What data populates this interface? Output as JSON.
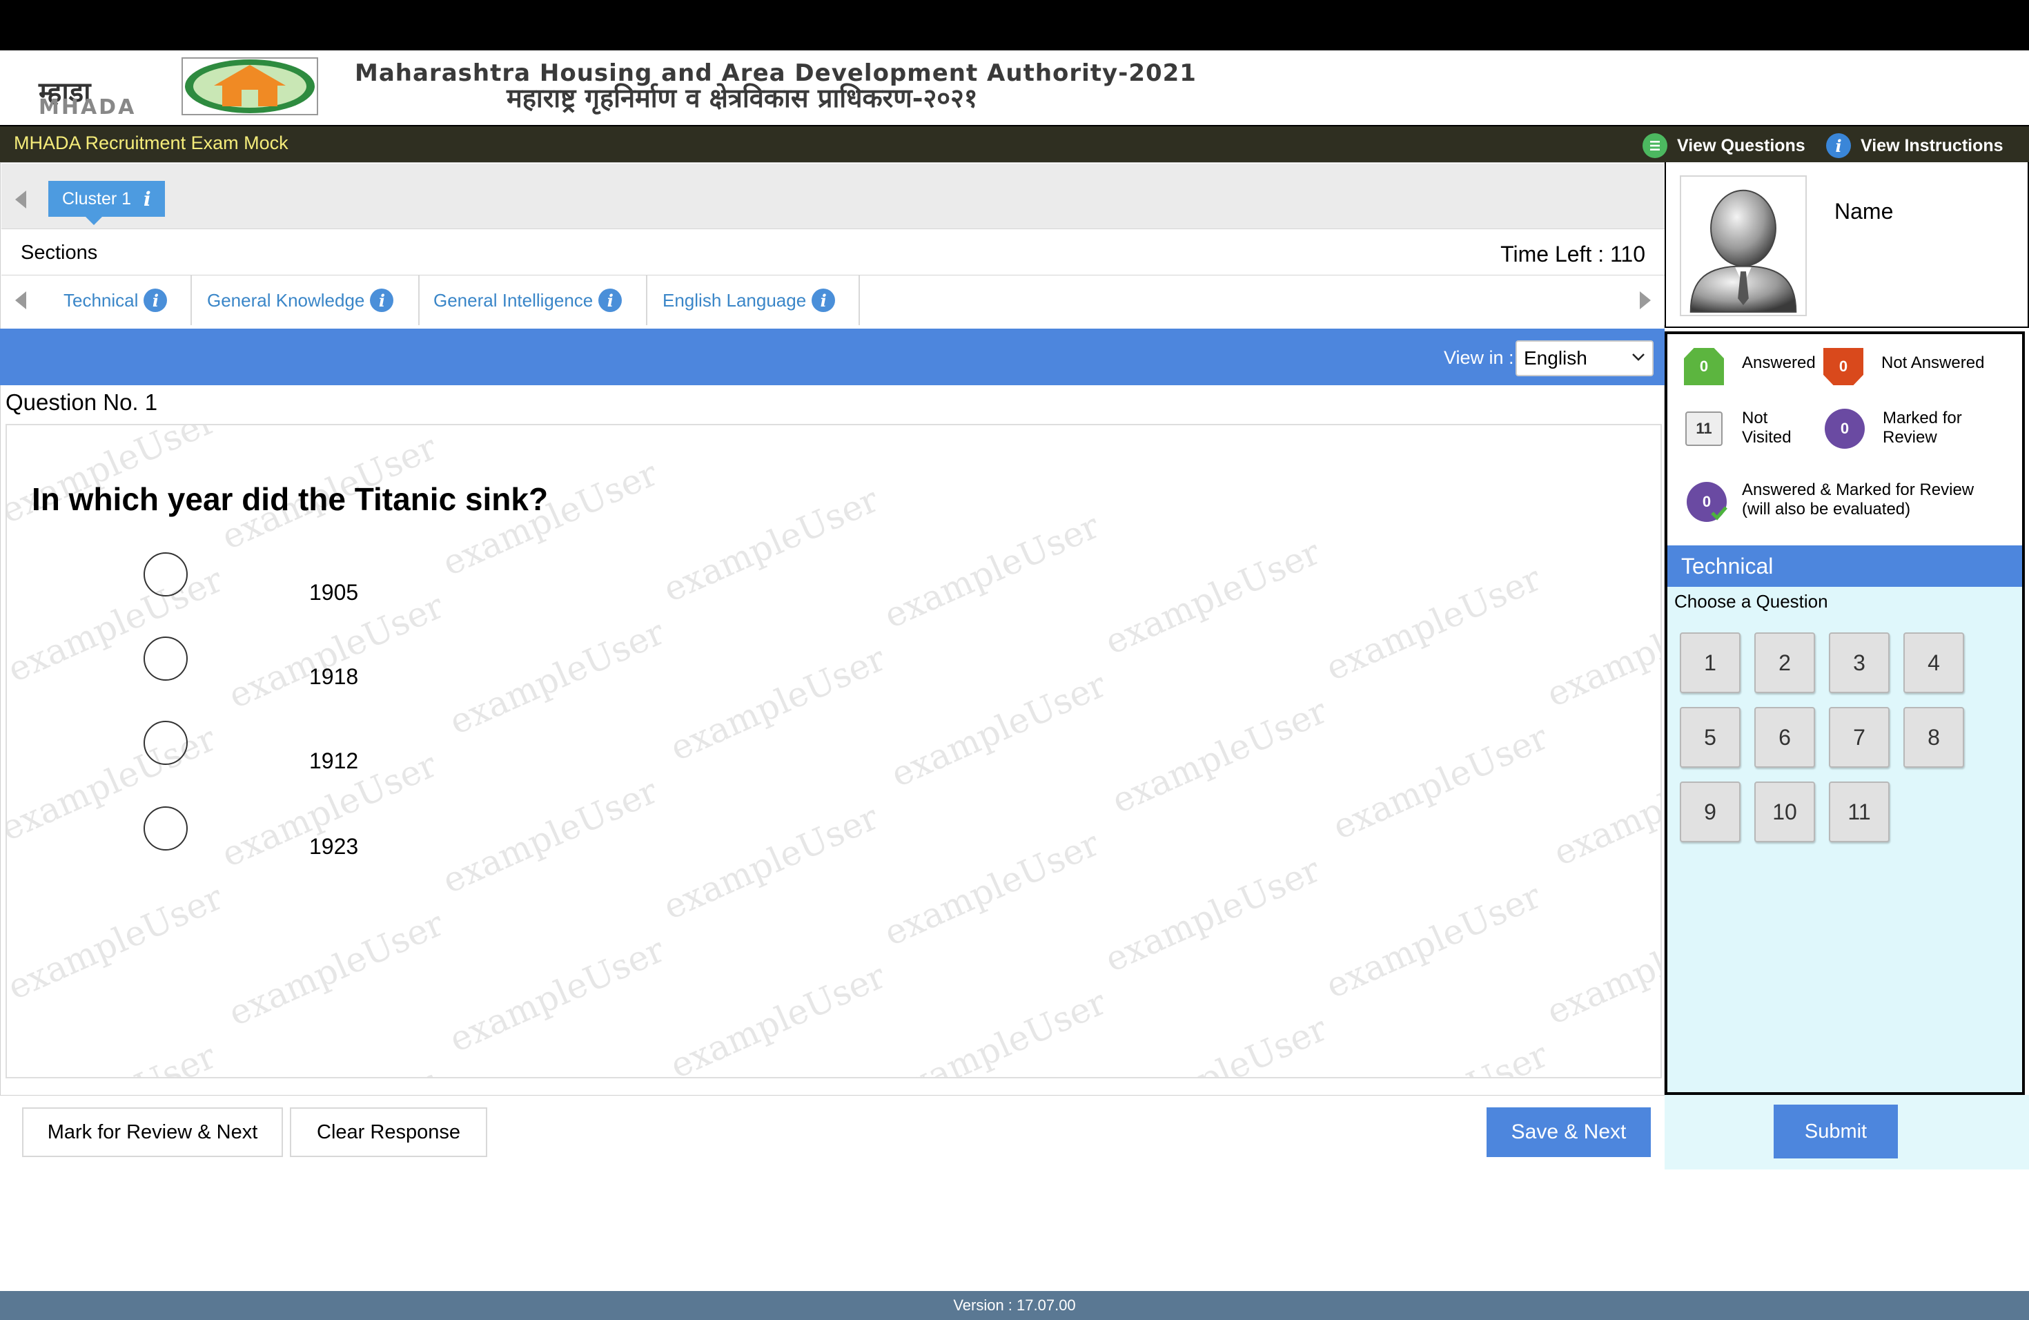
{
  "header": {
    "logo_hindi": "म्हाडा",
    "logo_latin": "MHADA",
    "org_name_en": "Maharashtra Housing and Area Development Authority-2021",
    "org_name_hi": "महाराष्ट्र गृहनिर्माण व क्षेत्रविकास प्राधिकरण-२०२१"
  },
  "titlebar": {
    "exam_title": "MHADA Recruitment Exam Mock",
    "view_questions": "View Questions",
    "view_instructions": "View Instructions"
  },
  "cluster": {
    "tab_label": "Cluster 1",
    "info_glyph": "i"
  },
  "sections": {
    "label": "Sections",
    "time_left": "Time Left : 110",
    "tabs": [
      {
        "label": "Technical"
      },
      {
        "label": "General Knowledge"
      },
      {
        "label": "General Intelligence"
      },
      {
        "label": "English Language"
      }
    ]
  },
  "view": {
    "label": "View in :",
    "language": "English"
  },
  "question": {
    "number_label": "Question No. 1",
    "text": "In which year did the Titanic sink?",
    "options": [
      "1905",
      "1918",
      "1912",
      "1923"
    ],
    "watermark": "exampleUser"
  },
  "actions": {
    "mark_review": "Mark for Review & Next",
    "clear": "Clear Response",
    "save_next": "Save & Next",
    "submit": "Submit"
  },
  "profile": {
    "name": "Name"
  },
  "legend": {
    "answered": {
      "count": "0",
      "label": "Answered"
    },
    "not_answered": {
      "count": "0",
      "label": "Not Answered"
    },
    "not_visited": {
      "count": "11",
      "label_line1": "Not",
      "label_line2": "Visited"
    },
    "marked_review": {
      "count": "0",
      "label_line1": "Marked for",
      "label_line2": "Review"
    },
    "answered_marked": {
      "count": "0",
      "label_line1": "Answered & Marked for Review",
      "label_line2": "(will also be evaluated)"
    }
  },
  "palette": {
    "section_name": "Technical",
    "choose_label": "Choose a Question",
    "questions": [
      "1",
      "2",
      "3",
      "4",
      "5",
      "6",
      "7",
      "8",
      "9",
      "10",
      "11"
    ]
  },
  "footer": {
    "version": "Version : 17.07.00"
  },
  "colors": {
    "accent_blue": "#4d86dd",
    "title_bar": "#2f2f21",
    "title_text": "#f5ec7a",
    "tab_link": "#3a86c8",
    "answered_green": "#5cb53f",
    "not_answered_red": "#d9491c",
    "review_purple": "#6a4aa2",
    "palette_bg": "#dff7fb",
    "footer_bg": "#5a7893"
  },
  "icons": {
    "view_questions": "list-icon",
    "view_instructions": "info-icon",
    "avatar": "user-avatar-icon"
  }
}
